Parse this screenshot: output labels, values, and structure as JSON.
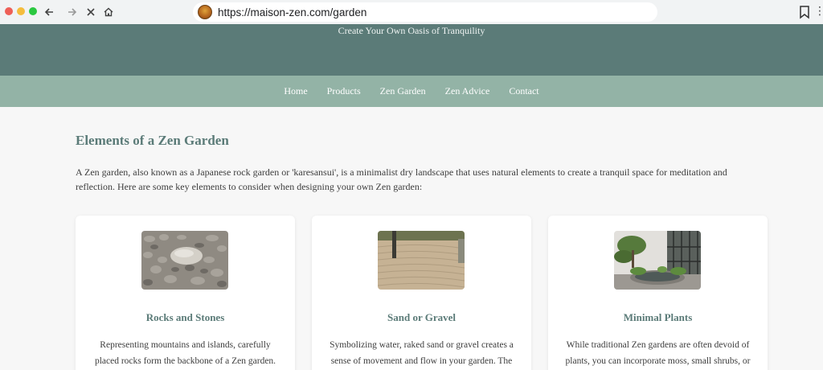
{
  "browser": {
    "url": "https://maison-zen.com/garden",
    "dots": [
      "#ee5f57",
      "#f5bd3d",
      "#2ac840"
    ],
    "icons": [
      "back-arrow-icon",
      "forward-arrow-icon",
      "stop-loading-icon",
      "home-icon",
      "bookmark-icon",
      "menu-icon"
    ]
  },
  "header": {
    "tagline": "Create Your Own Oasis of Tranquility"
  },
  "nav": {
    "items": [
      "Home",
      "Products",
      "Zen Garden",
      "Zen Advice",
      "Contact"
    ]
  },
  "main": {
    "title": "Elements of a Zen Garden",
    "intro": "A Zen garden, also known as a Japanese rock garden or 'karesansui', is a minimalist dry landscape that uses natural elements to create a tranquil space for meditation and reflection. Here are some key elements to consider when designing your own Zen garden:",
    "cards": [
      {
        "title": "Rocks and Stones",
        "text": "Representing mountains and islands, carefully placed rocks form the backbone of a Zen garden."
      },
      {
        "title": "Sand or Gravel",
        "text": "Symbolizing water, raked sand or gravel creates a sense of movement and flow in your garden. The"
      },
      {
        "title": "Minimal Plants",
        "text": "While traditional Zen gardens are often devoid of plants, you can incorporate moss, small shrubs, or"
      }
    ]
  },
  "colors": {
    "hero": "#5b7b78",
    "navbar": "#93b3a6",
    "accent": "#5b7b78"
  }
}
